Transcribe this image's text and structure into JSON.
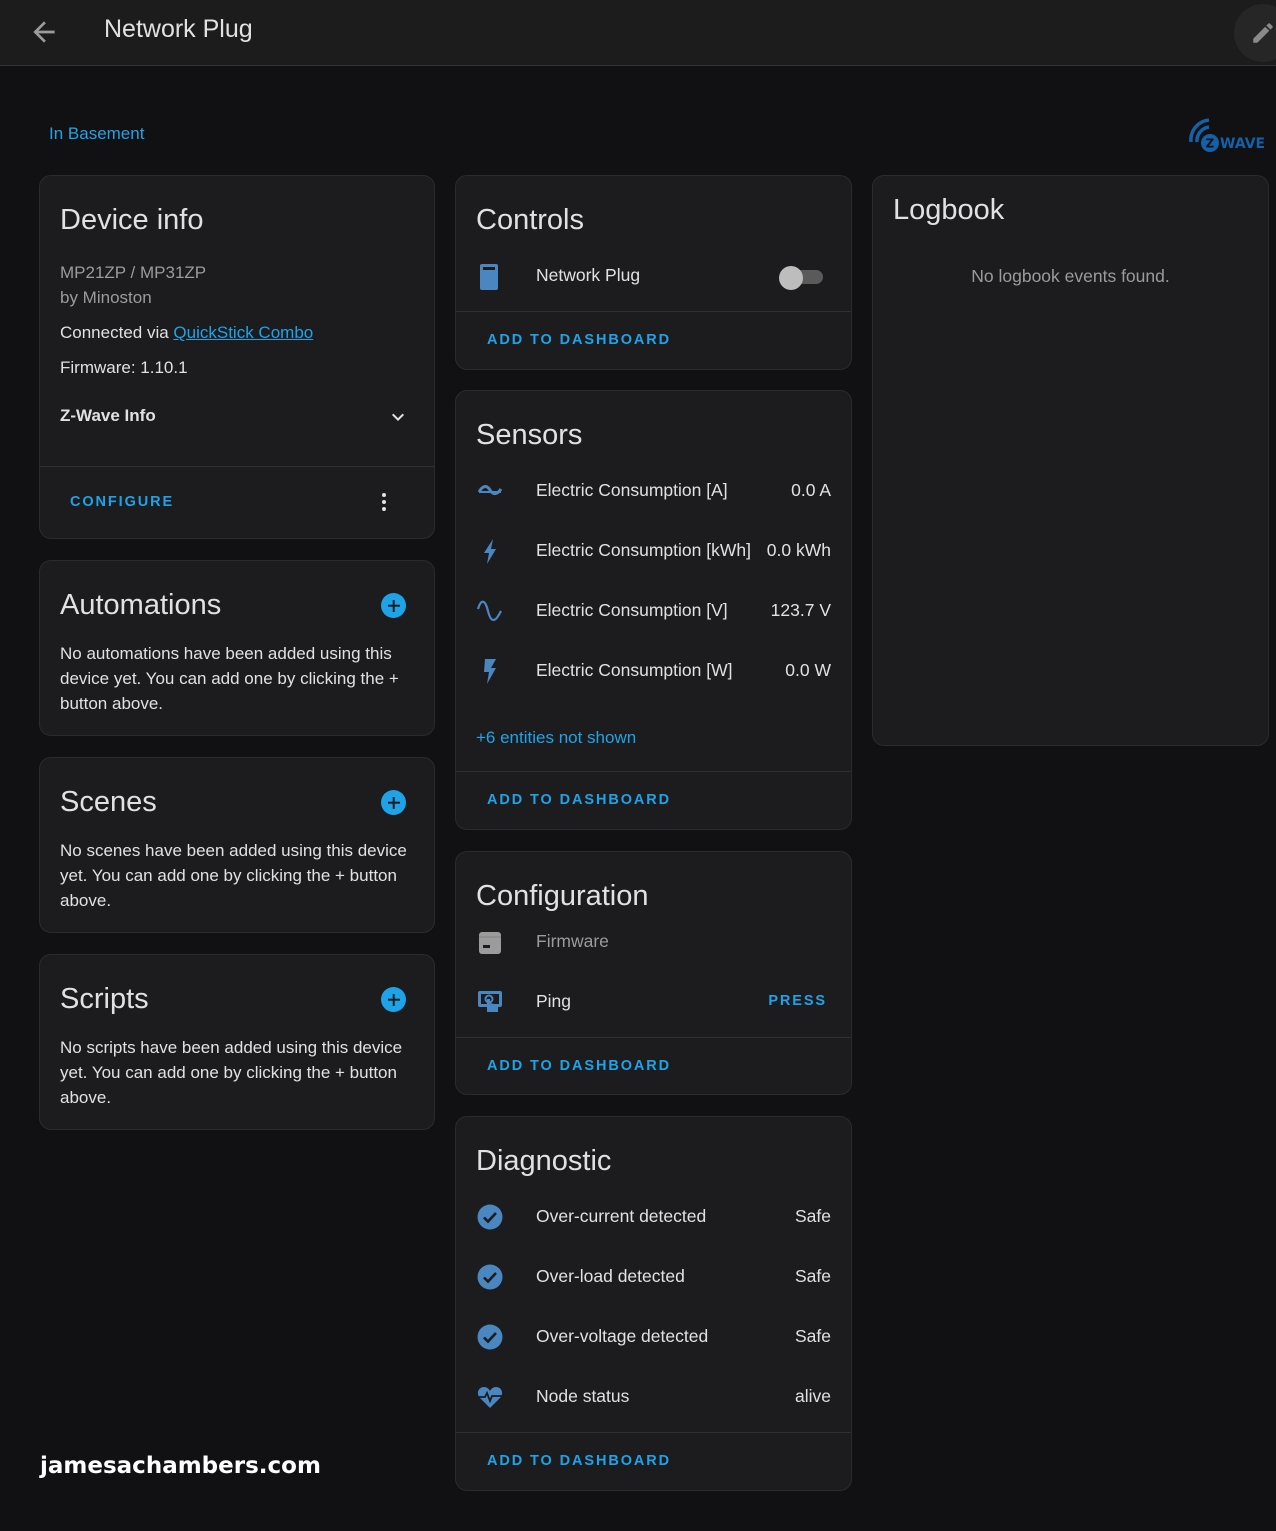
{
  "header": {
    "title": "Network Plug"
  },
  "area": "In Basement",
  "integration_logo": "zwave-logo",
  "device_info": {
    "title": "Device info",
    "model": "MP21ZP / MP31ZP",
    "manufacturer": "by Minoston",
    "connected_prefix": "Connected via ",
    "connected_link": "QuickStick Combo",
    "firmware": "Firmware: 1.10.1",
    "expander_label": "Z-Wave Info",
    "configure_label": "CONFIGURE"
  },
  "automations": {
    "title": "Automations",
    "empty_text": "No automations have been added using this device yet. You can add one by clicking the + button above."
  },
  "scenes": {
    "title": "Scenes",
    "empty_text": "No scenes have been added using this device yet. You can add one by clicking the + button above."
  },
  "scripts": {
    "title": "Scripts",
    "empty_text": "No scripts have been added using this device yet. You can add one by clicking the + button above."
  },
  "controls": {
    "title": "Controls",
    "items": [
      {
        "icon": "power-socket-icon",
        "label": "Network Plug",
        "state": "off"
      }
    ],
    "add_label": "ADD TO DASHBOARD"
  },
  "sensors": {
    "title": "Sensors",
    "items": [
      {
        "icon": "current-ac-icon",
        "label": "Electric Consumption [A]",
        "value": "0.0 A"
      },
      {
        "icon": "flash-icon",
        "label": "Electric Consumption [kWh]",
        "value": "0.0 kWh"
      },
      {
        "icon": "sine-wave-icon",
        "label": "Electric Consumption [V]",
        "value": "123.7 V"
      },
      {
        "icon": "flash-power-icon",
        "label": "Electric Consumption [W]",
        "value": "0.0 W"
      }
    ],
    "more_label": "+6 entities not shown",
    "add_label": "ADD TO DASHBOARD"
  },
  "configuration": {
    "title": "Configuration",
    "items": [
      {
        "icon": "firmware-icon",
        "label": "Firmware"
      },
      {
        "icon": "gesture-tap-button-icon",
        "label": "Ping",
        "action": "PRESS"
      }
    ],
    "add_label": "ADD TO DASHBOARD"
  },
  "diagnostic": {
    "title": "Diagnostic",
    "items": [
      {
        "icon": "check-circle-icon",
        "label": "Over-current detected",
        "value": "Safe"
      },
      {
        "icon": "check-circle-icon",
        "label": "Over-load detected",
        "value": "Safe"
      },
      {
        "icon": "check-circle-icon",
        "label": "Over-voltage detected",
        "value": "Safe"
      },
      {
        "icon": "heart-pulse-icon",
        "label": "Node status",
        "value": "alive"
      }
    ],
    "add_label": "ADD TO DASHBOARD"
  },
  "logbook": {
    "title": "Logbook",
    "empty_text": "No logbook events found."
  },
  "watermark": "jamesachambers.com",
  "colors": {
    "accent": "#1fa3e8",
    "icon": "#4a86c0",
    "background": "#111113",
    "card": "#1c1c1e"
  }
}
